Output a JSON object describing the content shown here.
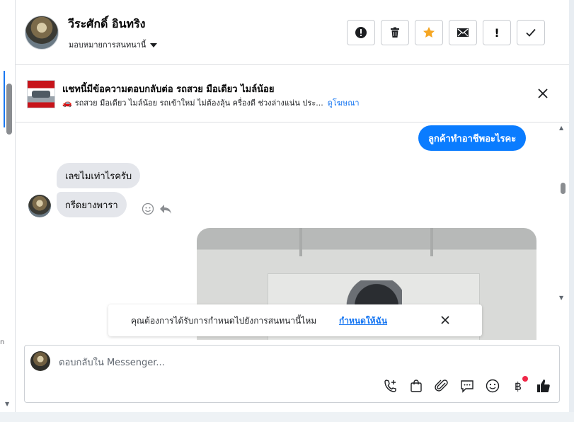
{
  "colors": {
    "accent": "#1877f2",
    "outgoing_bubble": "#0a7cff",
    "incoming_bubble": "#e4e6eb",
    "notification_dot": "#f02849"
  },
  "left_strip": {
    "glyph_top": "ี",
    "glyph_bottom": "n"
  },
  "header": {
    "name": "วีระศักดิ์ อินทริง",
    "status": "มอบหมายการสนทนานี้",
    "actions": [
      {
        "icon": "alert-circle-icon",
        "label": ""
      },
      {
        "icon": "trash-icon",
        "label": ""
      },
      {
        "icon": "star-icon",
        "label": ""
      },
      {
        "icon": "envelope-icon",
        "label": ""
      },
      {
        "icon": "exclamation-icon",
        "label": "!"
      },
      {
        "icon": "checkmark-icon",
        "label": ""
      }
    ]
  },
  "ad_banner": {
    "title": "แชทนี้มีข้อความตอบกลับต่อ รถสวย มือเดียว ไมล์น้อย",
    "subtitle": "รถสวย มือเดียว ไมล์น้อย รถเข้าใหม่ ไม่ต้องลุ้น ครื่องดี ช่วงล่างแน่น ประ...",
    "link": "ดูโฆษณา"
  },
  "messages": [
    {
      "direction": "out",
      "text": "ลูกค้าทำอาชีพอะไรคะ"
    },
    {
      "direction": "in",
      "text": "เลขไมเท่าไรครับ"
    },
    {
      "direction": "in",
      "text": "กรีดยางพารา"
    },
    {
      "direction": "out",
      "type": "photo"
    }
  ],
  "notice": {
    "text": "คุณต้องการได้รับการกำหนดไปยังการสนทนานี้ไหม",
    "link": "กำหนดให้ฉัน"
  },
  "composer": {
    "placeholder": "ตอบกลับใน Messenger...",
    "tools": [
      "phone-plus-icon",
      "shopping-bag-icon",
      "paperclip-icon",
      "chat-bubble-icon",
      "smiley-icon",
      "baht-icon",
      "thumbs-up-icon"
    ],
    "baht_symbol": "฿"
  }
}
